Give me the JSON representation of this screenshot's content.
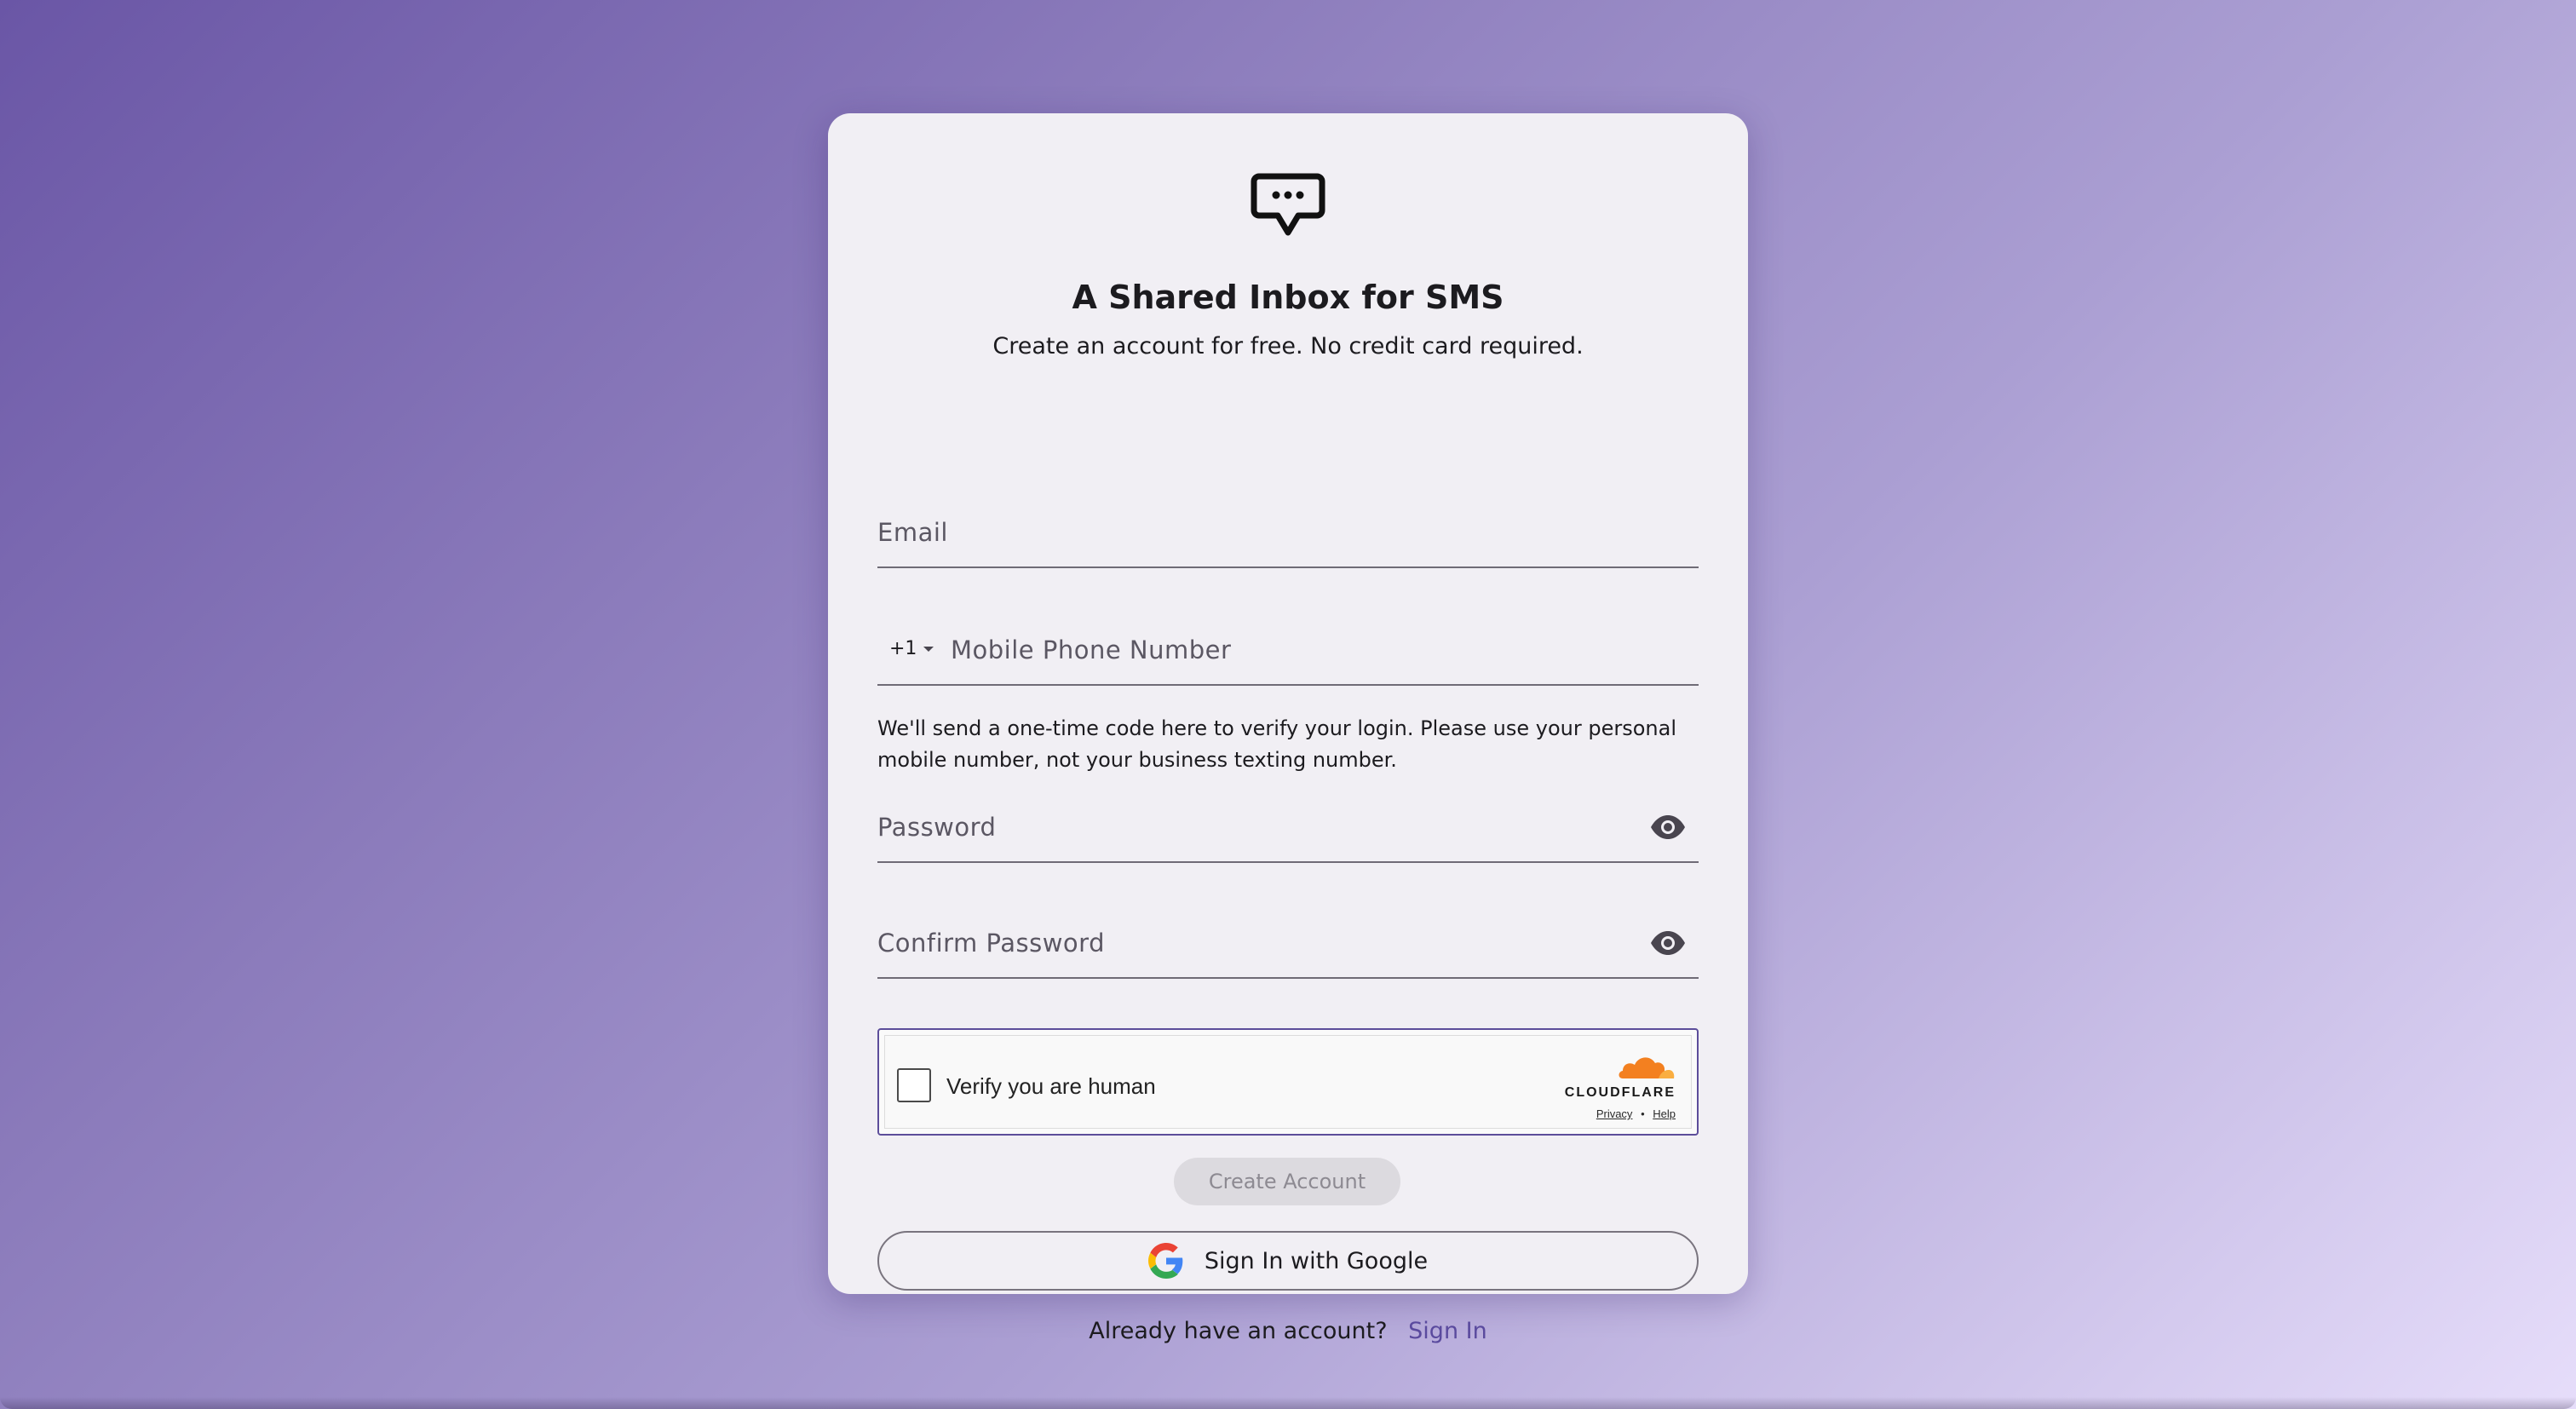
{
  "brand": {
    "icon": "chat-bubble-ellipsis-icon"
  },
  "header": {
    "title": "A Shared Inbox for SMS",
    "subtitle": "Create an account for free. No credit card required."
  },
  "form": {
    "email": {
      "placeholder": "Email",
      "value": ""
    },
    "phone": {
      "country_code": "+1",
      "placeholder": "Mobile Phone Number",
      "value": "",
      "helper": "We'll send a one-time code here to verify your login. Please use your personal mobile number, not your business texting number."
    },
    "password": {
      "placeholder": "Password",
      "value": "",
      "toggle_icon": "eye-icon"
    },
    "confirm_password": {
      "placeholder": "Confirm Password",
      "value": "",
      "toggle_icon": "eye-icon"
    }
  },
  "captcha": {
    "label": "Verify you are human",
    "provider": "CLOUDFLARE",
    "privacy_link": "Privacy",
    "separator": "•",
    "help_link": "Help",
    "checked": false
  },
  "actions": {
    "create_account": "Create Account",
    "create_account_enabled": false,
    "google_signin": "Sign In with Google",
    "already_have_account": "Already have an account?",
    "sign_in_link": "Sign In"
  },
  "colors": {
    "accent": "#5a4a9e",
    "card_background": "#f1eff4",
    "cloudflare_orange": "#f38020"
  }
}
